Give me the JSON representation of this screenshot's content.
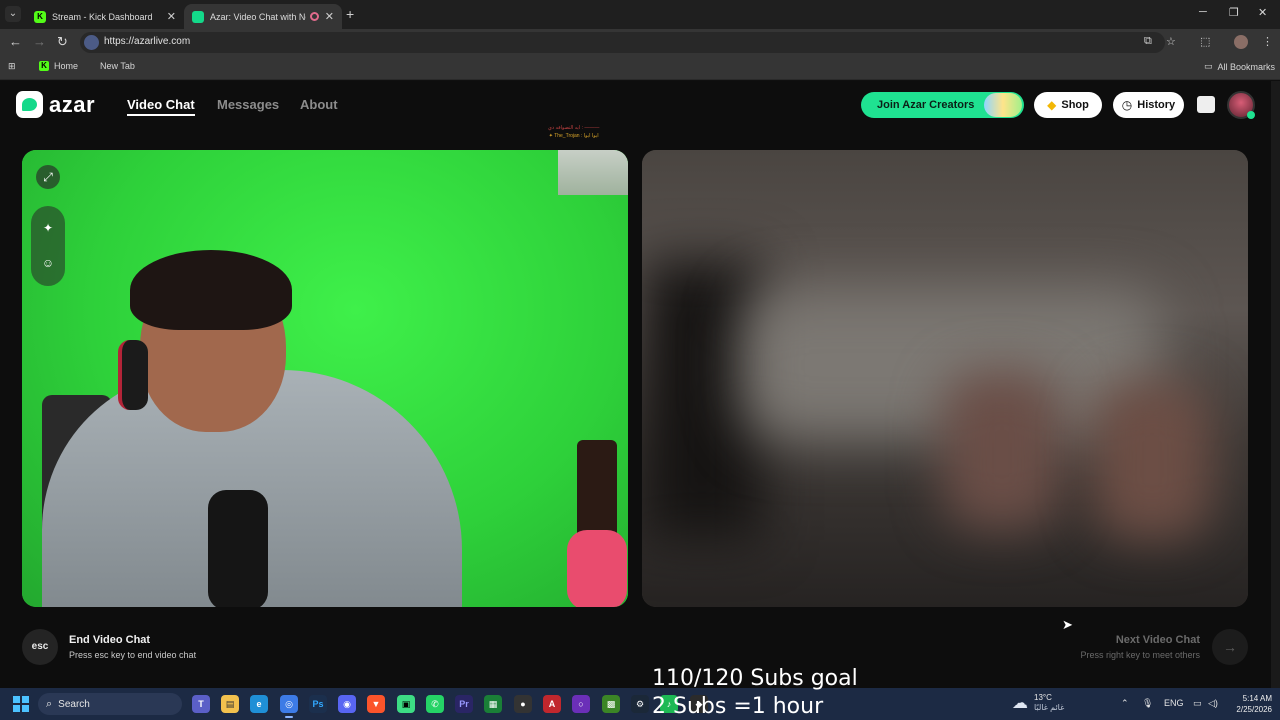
{
  "browser": {
    "tabs": [
      {
        "title": "Stream - Kick Dashboard",
        "favicon": "K",
        "active": false
      },
      {
        "title": "Azar: Video Chat with New",
        "favicon": "",
        "active": true
      }
    ],
    "url": "https://azarlive.com",
    "bookmarks": {
      "home": "Home",
      "new_tab": "New Tab",
      "all": "All Bookmarks"
    }
  },
  "app": {
    "logo_text": "azar",
    "nav": {
      "video_chat": "Video Chat",
      "messages": "Messages",
      "about": "About"
    },
    "join_creators": "Join Azar Creators",
    "shop": "Shop",
    "history": "History",
    "chat_overlay": {
      "line1": "ايه التصوافه دي : ———",
      "line2": "✦ The_Trojan : ايوا ايوا"
    },
    "end_chat": {
      "key": "esc",
      "title": "End Video Chat",
      "subtitle": "Press esc key to end video chat"
    },
    "next_chat": {
      "title": "Next Video Chat",
      "subtitle": "Press right key to meet others",
      "arrow": "→"
    }
  },
  "overlay": {
    "goal_line1": "110/120 Subs goal",
    "goal_line2": "2 Subs =1 hour"
  },
  "taskbar": {
    "search": "Search",
    "weather_temp": "13°C",
    "weather_desc": "غائم غالبًا",
    "lang": "ENG",
    "time": "5:14 AM",
    "date": "2/25/2026"
  },
  "colors": {
    "azar_green": "#1fe291",
    "chrome_bg": "#1f1f1f",
    "taskbar_bg": "#1c2a44"
  }
}
